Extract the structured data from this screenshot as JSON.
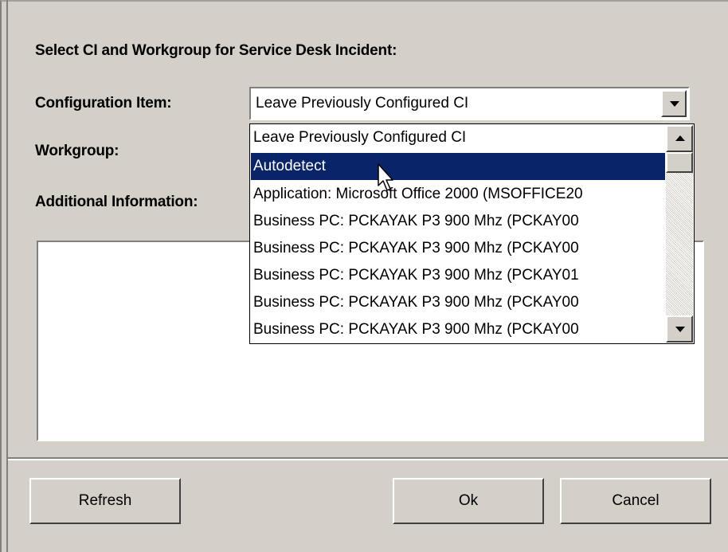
{
  "dialog": {
    "heading": "Select CI and Workgroup for Service Desk Incident:",
    "labels": {
      "configuration_item": "Configuration Item:",
      "workgroup": "Workgroup:",
      "additional_information": "Additional Information:"
    },
    "configuration_item": {
      "selected_value": "Leave Previously Configured CI",
      "options": [
        "Leave Previously Configured CI",
        "Autodetect",
        "Application: Microsoft Office 2000  (MSOFFICE20",
        "Business PC: PCKAYAK P3 900 Mhz  (PCKAY00",
        "Business PC: PCKAYAK P3 900 Mhz  (PCKAY00",
        "Business PC: PCKAYAK P3 900 Mhz  (PCKAY01",
        "Business PC: PCKAYAK P3 900 Mhz  (PCKAY00",
        "Business PC: PCKAYAK P3 900 Mhz  (PCKAY00"
      ],
      "highlighted_option": "Autodetect"
    },
    "additional_information_value": "",
    "buttons": {
      "refresh": "Refresh",
      "ok": "Ok",
      "cancel": "Cancel"
    }
  },
  "colors": {
    "dialog_background": "#d4d0c8",
    "selection_background": "#0a246a",
    "selection_text": "#ffffff"
  },
  "icons": [
    "chevron-down-icon",
    "scroll-up-icon",
    "scroll-down-icon",
    "mouse-cursor-icon"
  ]
}
